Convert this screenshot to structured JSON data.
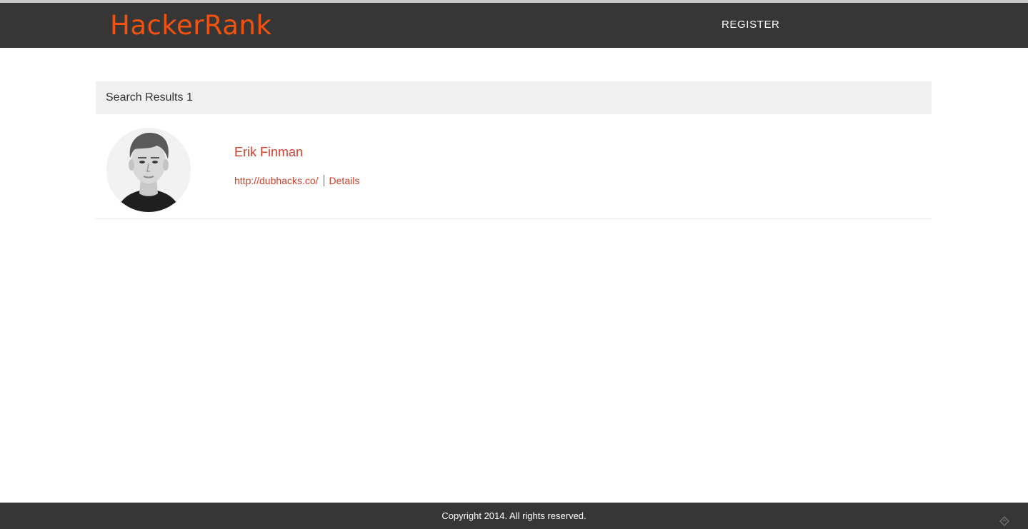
{
  "header": {
    "brand": "HackerRank",
    "nav_register": "REGISTER"
  },
  "results": {
    "title": "Search Results 1",
    "items": [
      {
        "name": "Erik Finman",
        "website": "http://dubhacks.co/",
        "details_label": "Details",
        "avatar_icon": "profile-photo"
      }
    ]
  },
  "footer": {
    "copyright": "Copyright 2014. All rights reserved.",
    "corner_icon": "resize-grip-icon"
  },
  "colors": {
    "brand": "#f1530f",
    "link": "#d23f2b",
    "nav_bg": "#363636",
    "results_bar_bg": "#f0f0f0"
  }
}
